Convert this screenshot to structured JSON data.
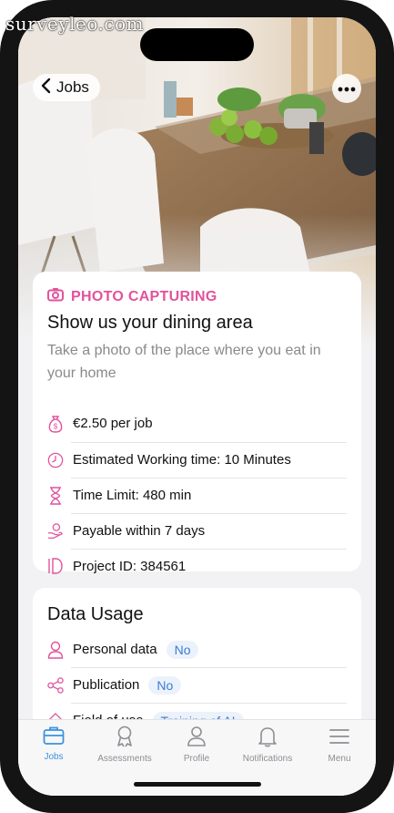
{
  "watermark": "surveyleo.com",
  "nav": {
    "back_label": "Jobs",
    "more": "more-options"
  },
  "job": {
    "category": "PHOTO CAPTURING",
    "title": "Show us your dining area",
    "description": "Take a photo of the place where you eat in your home",
    "details": [
      {
        "icon": "money-bag-icon",
        "text": "€2.50 per job"
      },
      {
        "icon": "clock-icon",
        "text": "Estimated Working time: 10 Minutes"
      },
      {
        "icon": "hourglass-icon",
        "text": "Time Limit: 480 min"
      },
      {
        "icon": "payment-hand-icon",
        "text": "Payable within 7 days"
      },
      {
        "icon": "id-icon",
        "text": "Project ID: 384561"
      }
    ]
  },
  "data_usage": {
    "title": "Data Usage",
    "rows": [
      {
        "icon": "person-icon",
        "label": "Personal data",
        "value": "No"
      },
      {
        "icon": "share-icon",
        "label": "Publication",
        "value": "No"
      },
      {
        "icon": "diamond-icon",
        "label": "Field of use",
        "value": "Training of AI"
      }
    ]
  },
  "tabs": [
    {
      "label": "Jobs",
      "icon": "briefcase-icon",
      "active": true
    },
    {
      "label": "Assessments",
      "icon": "award-icon",
      "active": false
    },
    {
      "label": "Profile",
      "icon": "profile-icon",
      "active": false
    },
    {
      "label": "Notifications",
      "icon": "bell-icon",
      "active": false
    },
    {
      "label": "Menu",
      "icon": "menu-icon",
      "active": false
    }
  ],
  "colors": {
    "accent": "#e2529c",
    "tab_active": "#3a93e0",
    "badge_text": "#3a7bd5",
    "badge_bg": "#ecf2fb"
  }
}
